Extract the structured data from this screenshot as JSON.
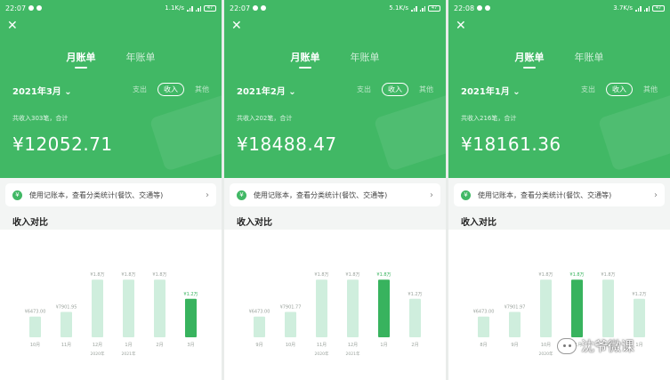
{
  "colors": {
    "primary": "#41b865",
    "bar_light": "#cfeedd",
    "bar_dark": "#38b35e",
    "muted": "#9aa29c"
  },
  "icons": {
    "close": "close-icon",
    "dropdown": "chevron-down-icon",
    "ledger": "ledger-icon",
    "forward": "chevron-right-icon"
  },
  "screens": [
    {
      "status": {
        "time": "22:07",
        "speed": "1.1K/s",
        "battery": "47"
      },
      "tabs": [
        "月账单",
        "年账单"
      ],
      "month": "2021年3月",
      "type_tabs": [
        "支出",
        "收入",
        "其他"
      ],
      "summary": "共收入303笔，合计",
      "amount": "¥12052.71",
      "banner": "使用记账本，查看分类统计(餐饮、交通等)",
      "chart_title": "收入对比",
      "chart_data": {
        "type": "bar",
        "categories": [
          "10月",
          "11月",
          "12月",
          "1月",
          "2月",
          "3月"
        ],
        "values": [
          6473,
          7901,
          18000,
          18000,
          18000,
          12000
        ],
        "labels": [
          "¥6473.00",
          "¥7901.95",
          "¥1.8万",
          "¥1.8万",
          "¥1.8万",
          "¥1.2万"
        ],
        "highlight_index": 5,
        "year_labels": [
          "2020年",
          "2021年"
        ],
        "ylim": [
          0,
          20000
        ]
      }
    },
    {
      "status": {
        "time": "22:07",
        "speed": "5.1K/s",
        "battery": "47"
      },
      "tabs": [
        "月账单",
        "年账单"
      ],
      "month": "2021年2月",
      "type_tabs": [
        "支出",
        "收入",
        "其他"
      ],
      "summary": "共收入202笔，合计",
      "amount": "¥18488.47",
      "banner": "使用记账本，查看分类统计(餐饮、交通等)",
      "chart_title": "收入对比",
      "chart_data": {
        "type": "bar",
        "categories": [
          "9月",
          "10月",
          "11月",
          "12月",
          "1月",
          "2月"
        ],
        "values": [
          6473,
          7901,
          18000,
          18000,
          18000,
          12000
        ],
        "labels": [
          "¥6473.00",
          "¥7901.77",
          "¥1.8万",
          "¥1.8万",
          "¥1.8万",
          "¥1.2万"
        ],
        "highlight_index": 4,
        "year_labels": [
          "2020年",
          "2021年"
        ],
        "ylim": [
          0,
          20000
        ]
      }
    },
    {
      "status": {
        "time": "22:08",
        "speed": "3.7K/s",
        "battery": "47"
      },
      "tabs": [
        "月账单",
        "年账单"
      ],
      "month": "2021年1月",
      "type_tabs": [
        "支出",
        "收入",
        "其他"
      ],
      "summary": "共收入216笔，合计",
      "amount": "¥18161.36",
      "banner": "使用记账本，查看分类统计(餐饮、交通等)",
      "chart_title": "收入对比",
      "chart_data": {
        "type": "bar",
        "categories": [
          "8月",
          "9月",
          "10月",
          "11月",
          "12月",
          "1月"
        ],
        "values": [
          6473,
          7901,
          18000,
          18000,
          18000,
          12000
        ],
        "labels": [
          "¥6473.00",
          "¥7901.97",
          "¥1.8万",
          "¥1.8万",
          "¥1.8万",
          "¥1.2万"
        ],
        "highlight_index": 3,
        "year_labels": [
          "2020年"
        ],
        "ylim": [
          0,
          20000
        ]
      }
    }
  ],
  "watermark": "沈爷微课"
}
